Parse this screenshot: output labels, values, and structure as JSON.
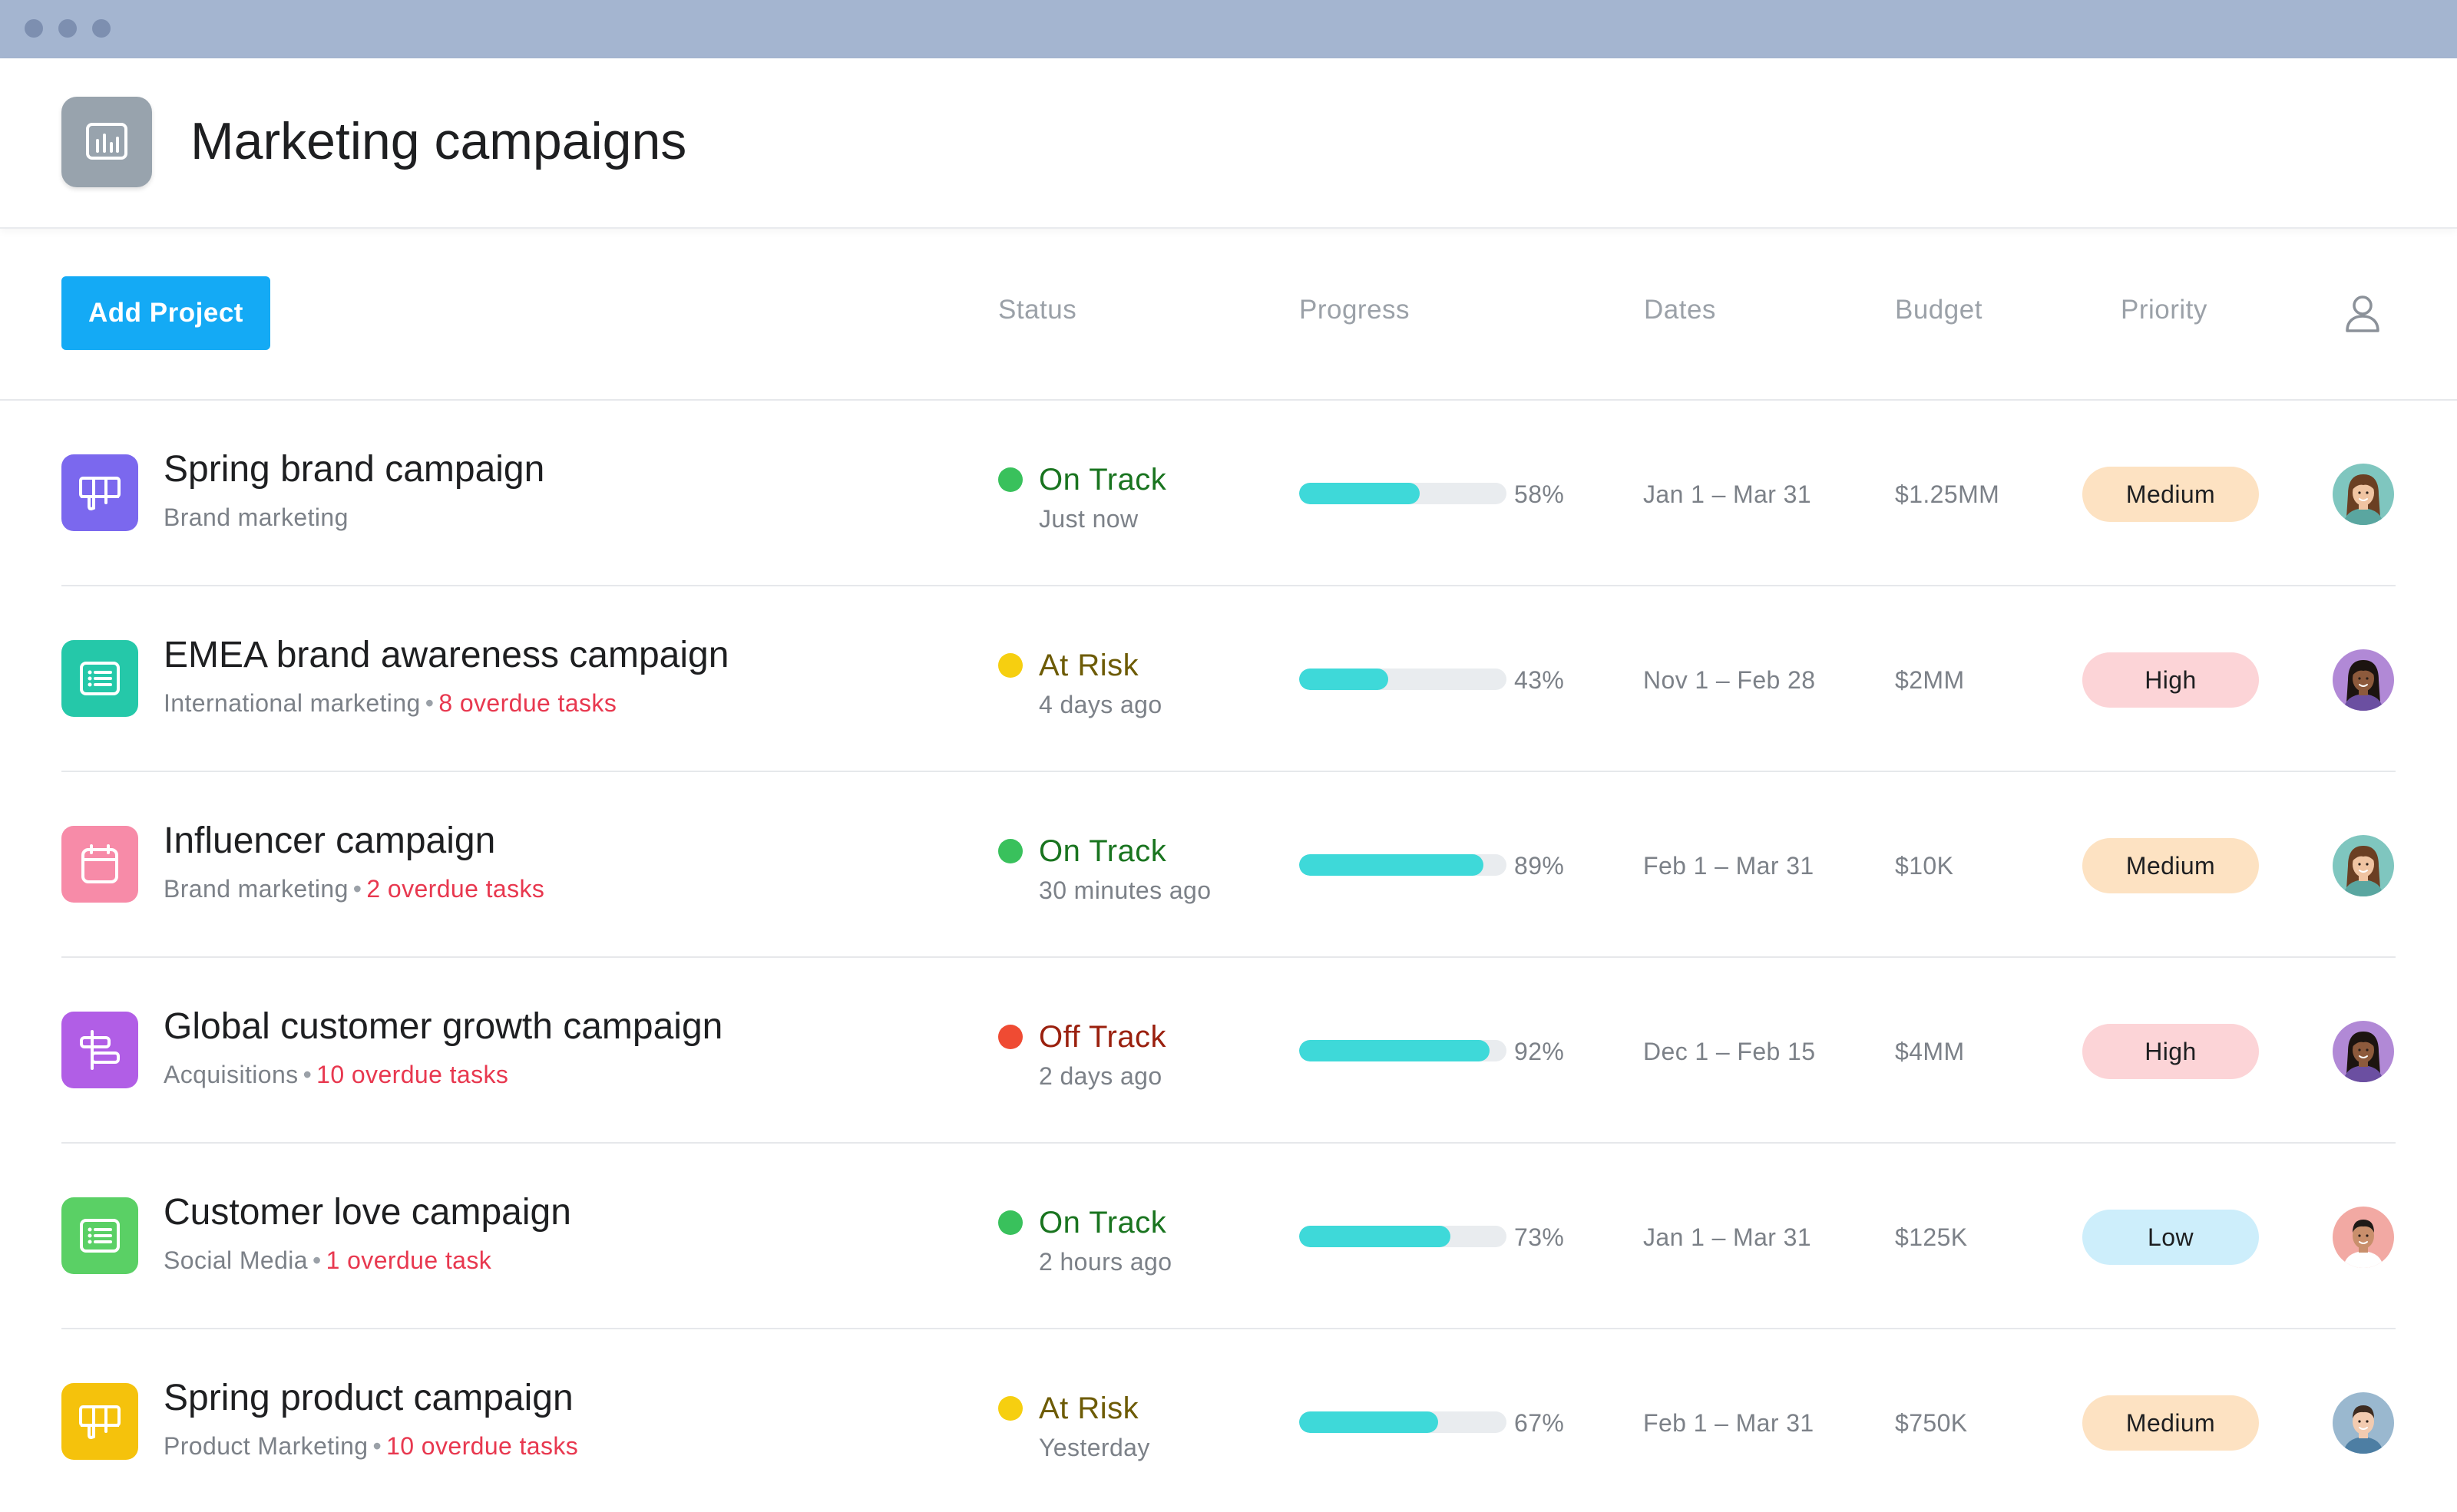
{
  "window": {
    "title_dots": [
      "close",
      "minimize",
      "maximize"
    ]
  },
  "header": {
    "title": "Marketing campaigns",
    "icon": "bar-chart-icon",
    "icon_color": "#98a3ad"
  },
  "toolbar": {
    "add_label": "Add Project",
    "columns": {
      "status": "Status",
      "progress": "Progress",
      "dates": "Dates",
      "budget": "Budget",
      "priority": "Priority",
      "assignee_icon": "person-icon"
    }
  },
  "colors": {
    "accent": "#14aaf5",
    "on_track": "#39c15c",
    "on_track_text": "#19741f",
    "at_risk": "#f6cf10",
    "at_risk_text": "#6d5b05",
    "off_track": "#ef4b33",
    "off_track_text": "#9a200e",
    "progress": "#3ed9d9",
    "pill_medium": "#fde2c2",
    "pill_high": "#fcd4d7",
    "pill_low": "#cdeefb",
    "overdue": "#e8384f"
  },
  "rows": [
    {
      "title": "Spring brand campaign",
      "team": "Brand marketing",
      "overdue": "",
      "icon": "board-icon",
      "icon_color": "#7b68ee",
      "status": "On Track",
      "status_key": "on_track",
      "updated": "Just now",
      "progress": 0.58,
      "progress_label": "58%",
      "dates": "Jan 1 – Mar 31",
      "budget": "$1.25MM",
      "priority": "Medium",
      "priority_key": "medium",
      "avatar": "woman-avatar-1"
    },
    {
      "title": "EMEA brand awareness campaign",
      "team": "International marketing",
      "overdue": "8 overdue tasks",
      "icon": "list-icon",
      "icon_color": "#25c8a9",
      "status": "At Risk",
      "status_key": "at_risk",
      "updated": "4 days ago",
      "progress": 0.43,
      "progress_label": "43%",
      "dates": "Nov 1 – Feb 28",
      "budget": "$2MM",
      "priority": "High",
      "priority_key": "high",
      "avatar": "woman-avatar-2"
    },
    {
      "title": "Influencer campaign",
      "team": "Brand marketing",
      "overdue": "2 overdue tasks",
      "icon": "calendar-icon",
      "icon_color": "#f78ba8",
      "status": "On Track",
      "status_key": "on_track",
      "updated": "30 minutes ago",
      "progress": 0.89,
      "progress_label": "89%",
      "dates": "Feb 1 – Mar 31",
      "budget": "$10K",
      "priority": "Medium",
      "priority_key": "medium",
      "avatar": "woman-avatar-1"
    },
    {
      "title": "Global customer growth campaign",
      "team": "Acquisitions",
      "overdue": "10 overdue tasks",
      "icon": "timeline-icon",
      "icon_color": "#b15ee6",
      "status": "Off Track",
      "status_key": "off_track",
      "updated": "2 days ago",
      "progress": 0.92,
      "progress_label": "92%",
      "dates": "Dec 1 – Feb 15",
      "budget": "$4MM",
      "priority": "High",
      "priority_key": "high",
      "avatar": "woman-avatar-2"
    },
    {
      "title": "Customer love campaign",
      "team": "Social Media",
      "overdue": "1 overdue task",
      "icon": "list-icon",
      "icon_color": "#5ad065",
      "status": "On Track",
      "status_key": "on_track",
      "updated": "2 hours ago",
      "progress": 0.73,
      "progress_label": "73%",
      "dates": "Jan 1 – Mar 31",
      "budget": "$125K",
      "priority": "Low",
      "priority_key": "low",
      "avatar": "man-avatar-1"
    },
    {
      "title": "Spring product campaign",
      "team": "Product Marketing",
      "overdue": "10 overdue tasks",
      "icon": "board-icon",
      "icon_color": "#f5c20c",
      "status": "At Risk",
      "status_key": "at_risk",
      "updated": "Yesterday",
      "progress": 0.67,
      "progress_label": "67%",
      "dates": "Feb 1 – Mar 31",
      "budget": "$750K",
      "priority": "Medium",
      "priority_key": "medium",
      "avatar": "man-avatar-2"
    }
  ]
}
